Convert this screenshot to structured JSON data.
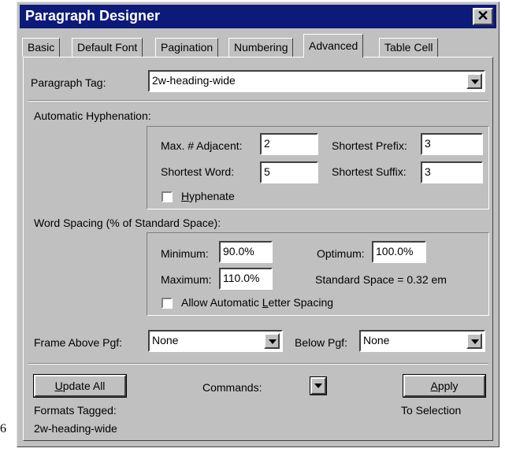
{
  "window": {
    "title": "Paragraph Designer",
    "close_glyph": "✕"
  },
  "stray_digit": "6",
  "tabs": [
    {
      "label": "Basic"
    },
    {
      "label": "Default Font"
    },
    {
      "label": "Pagination"
    },
    {
      "label": "Numbering"
    },
    {
      "label": "Advanced",
      "active": true
    },
    {
      "label": "Table Cell"
    }
  ],
  "paragraph_tag": {
    "label": "Paragraph Tag:",
    "value": "2w-heading-wide"
  },
  "hyphenation": {
    "heading": "Automatic Hyphenation:",
    "max_adjacent_label": "Max. # Adjacent:",
    "max_adjacent_value": "2",
    "shortest_prefix_label": "Shortest Prefix:",
    "shortest_prefix_value": "3",
    "shortest_word_label": "Shortest Word:",
    "shortest_word_value": "5",
    "shortest_suffix_label": "Shortest Suffix:",
    "shortest_suffix_value": "3",
    "hyphenate_pre": "",
    "hyphenate_key": "H",
    "hyphenate_post": "yphenate",
    "hyphenate_checked": false
  },
  "word_spacing": {
    "heading": "Word Spacing (% of Standard Space):",
    "minimum_label": "Minimum:",
    "minimum_value": "90.0%",
    "optimum_label": "Optimum:",
    "optimum_value": "100.0%",
    "maximum_label": "Maximum:",
    "maximum_value": "110.0%",
    "standard_space": "Standard Space = 0.32 em",
    "letter_pre": "Allow Automatic ",
    "letter_key": "L",
    "letter_post": "etter Spacing",
    "letter_checked": false
  },
  "frames": {
    "above_label": "Frame Above Pgf:",
    "above_value": "None",
    "below_label": "Below Pgf:",
    "below_value": "None"
  },
  "footer": {
    "update_key": "U",
    "update_rest": "pdate All",
    "formats_tagged_label": "Formats Tagged:",
    "formats_tagged_value": "2w-heading-wide",
    "commands_label": "Commands:",
    "apply_key": "A",
    "apply_rest": "pply",
    "to_selection": "To Selection"
  }
}
